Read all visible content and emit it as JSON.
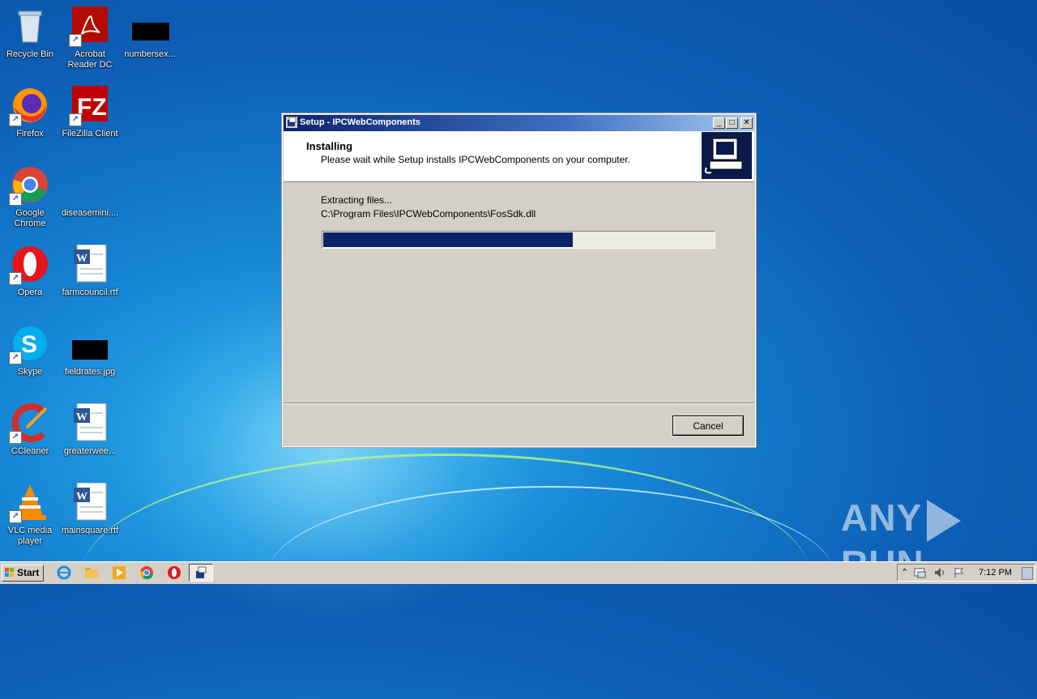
{
  "desktop": {
    "icons": [
      {
        "label": "Recycle Bin"
      },
      {
        "label": "Acrobat Reader DC"
      },
      {
        "label": "numbersex..."
      },
      {
        "label": "Firefox"
      },
      {
        "label": "FileZilla Client"
      },
      {
        "label": "Google Chrome"
      },
      {
        "label": "diseasemini...."
      },
      {
        "label": "Opera"
      },
      {
        "label": "farmcouncil.rtf"
      },
      {
        "label": "Skype"
      },
      {
        "label": "fieldrates.jpg"
      },
      {
        "label": "CCleaner"
      },
      {
        "label": "greaterwee..."
      },
      {
        "label": "VLC media player"
      },
      {
        "label": "mainsquare.rtf"
      }
    ]
  },
  "window": {
    "title": "Setup - IPCWebComponents",
    "header_title": "Installing",
    "header_subtitle": "Please wait while Setup installs IPCWebComponents on your computer.",
    "status_text": "Extracting files...",
    "current_file": "C:\\Program Files\\IPCWebComponents\\FosSdk.dll",
    "progress_fraction": 0.64,
    "cancel_label": "Cancel",
    "accent_color": "#0a246a"
  },
  "taskbar": {
    "start_label": "Start",
    "clock": "7:12 PM"
  },
  "watermark": {
    "left": "ANY",
    "right": "RUN"
  }
}
